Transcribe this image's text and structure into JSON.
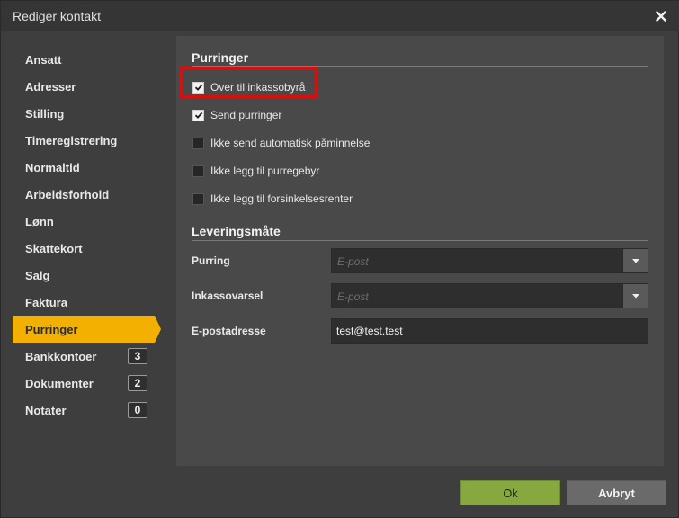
{
  "dialog": {
    "title": "Rediger kontakt",
    "close_icon": "close-icon"
  },
  "sidebar": {
    "items": [
      {
        "label": "Ansatt",
        "active": false
      },
      {
        "label": "Adresser",
        "active": false
      },
      {
        "label": "Stilling",
        "active": false
      },
      {
        "label": "Timeregistrering",
        "active": false
      },
      {
        "label": "Normaltid",
        "active": false
      },
      {
        "label": "Arbeidsforhold",
        "active": false
      },
      {
        "label": "Lønn",
        "active": false
      },
      {
        "label": "Skattekort",
        "active": false
      },
      {
        "label": "Salg",
        "active": false
      },
      {
        "label": "Faktura",
        "active": false
      },
      {
        "label": "Purringer",
        "active": true
      },
      {
        "label": "Bankkontoer",
        "active": false,
        "badge": "3"
      },
      {
        "label": "Dokumenter",
        "active": false,
        "badge": "2"
      },
      {
        "label": "Notater",
        "active": false,
        "badge": "0"
      }
    ],
    "active_color": "#f4b000"
  },
  "purringer": {
    "title": "Purringer",
    "checkboxes": [
      {
        "label": "Over til inkassobyrå",
        "checked": true,
        "highlighted": true
      },
      {
        "label": "Send purringer",
        "checked": true
      },
      {
        "label": "Ikke send automatisk påminnelse",
        "checked": false
      },
      {
        "label": "Ikke legg til purregebyr",
        "checked": false
      },
      {
        "label": "Ikke legg til forsinkelsesrenter",
        "checked": false
      }
    ],
    "highlight_color": "#d90f0f"
  },
  "levering": {
    "title": "Leveringsmåte",
    "purring_label": "Purring",
    "purring_value": "E-post",
    "inkasso_label": "Inkassovarsel",
    "inkasso_value": "E-post",
    "epost_label": "E-postadresse",
    "epost_value": "test@test.test"
  },
  "footer": {
    "ok_label": "Ok",
    "cancel_label": "Avbryt",
    "ok_color": "#86a83f"
  }
}
